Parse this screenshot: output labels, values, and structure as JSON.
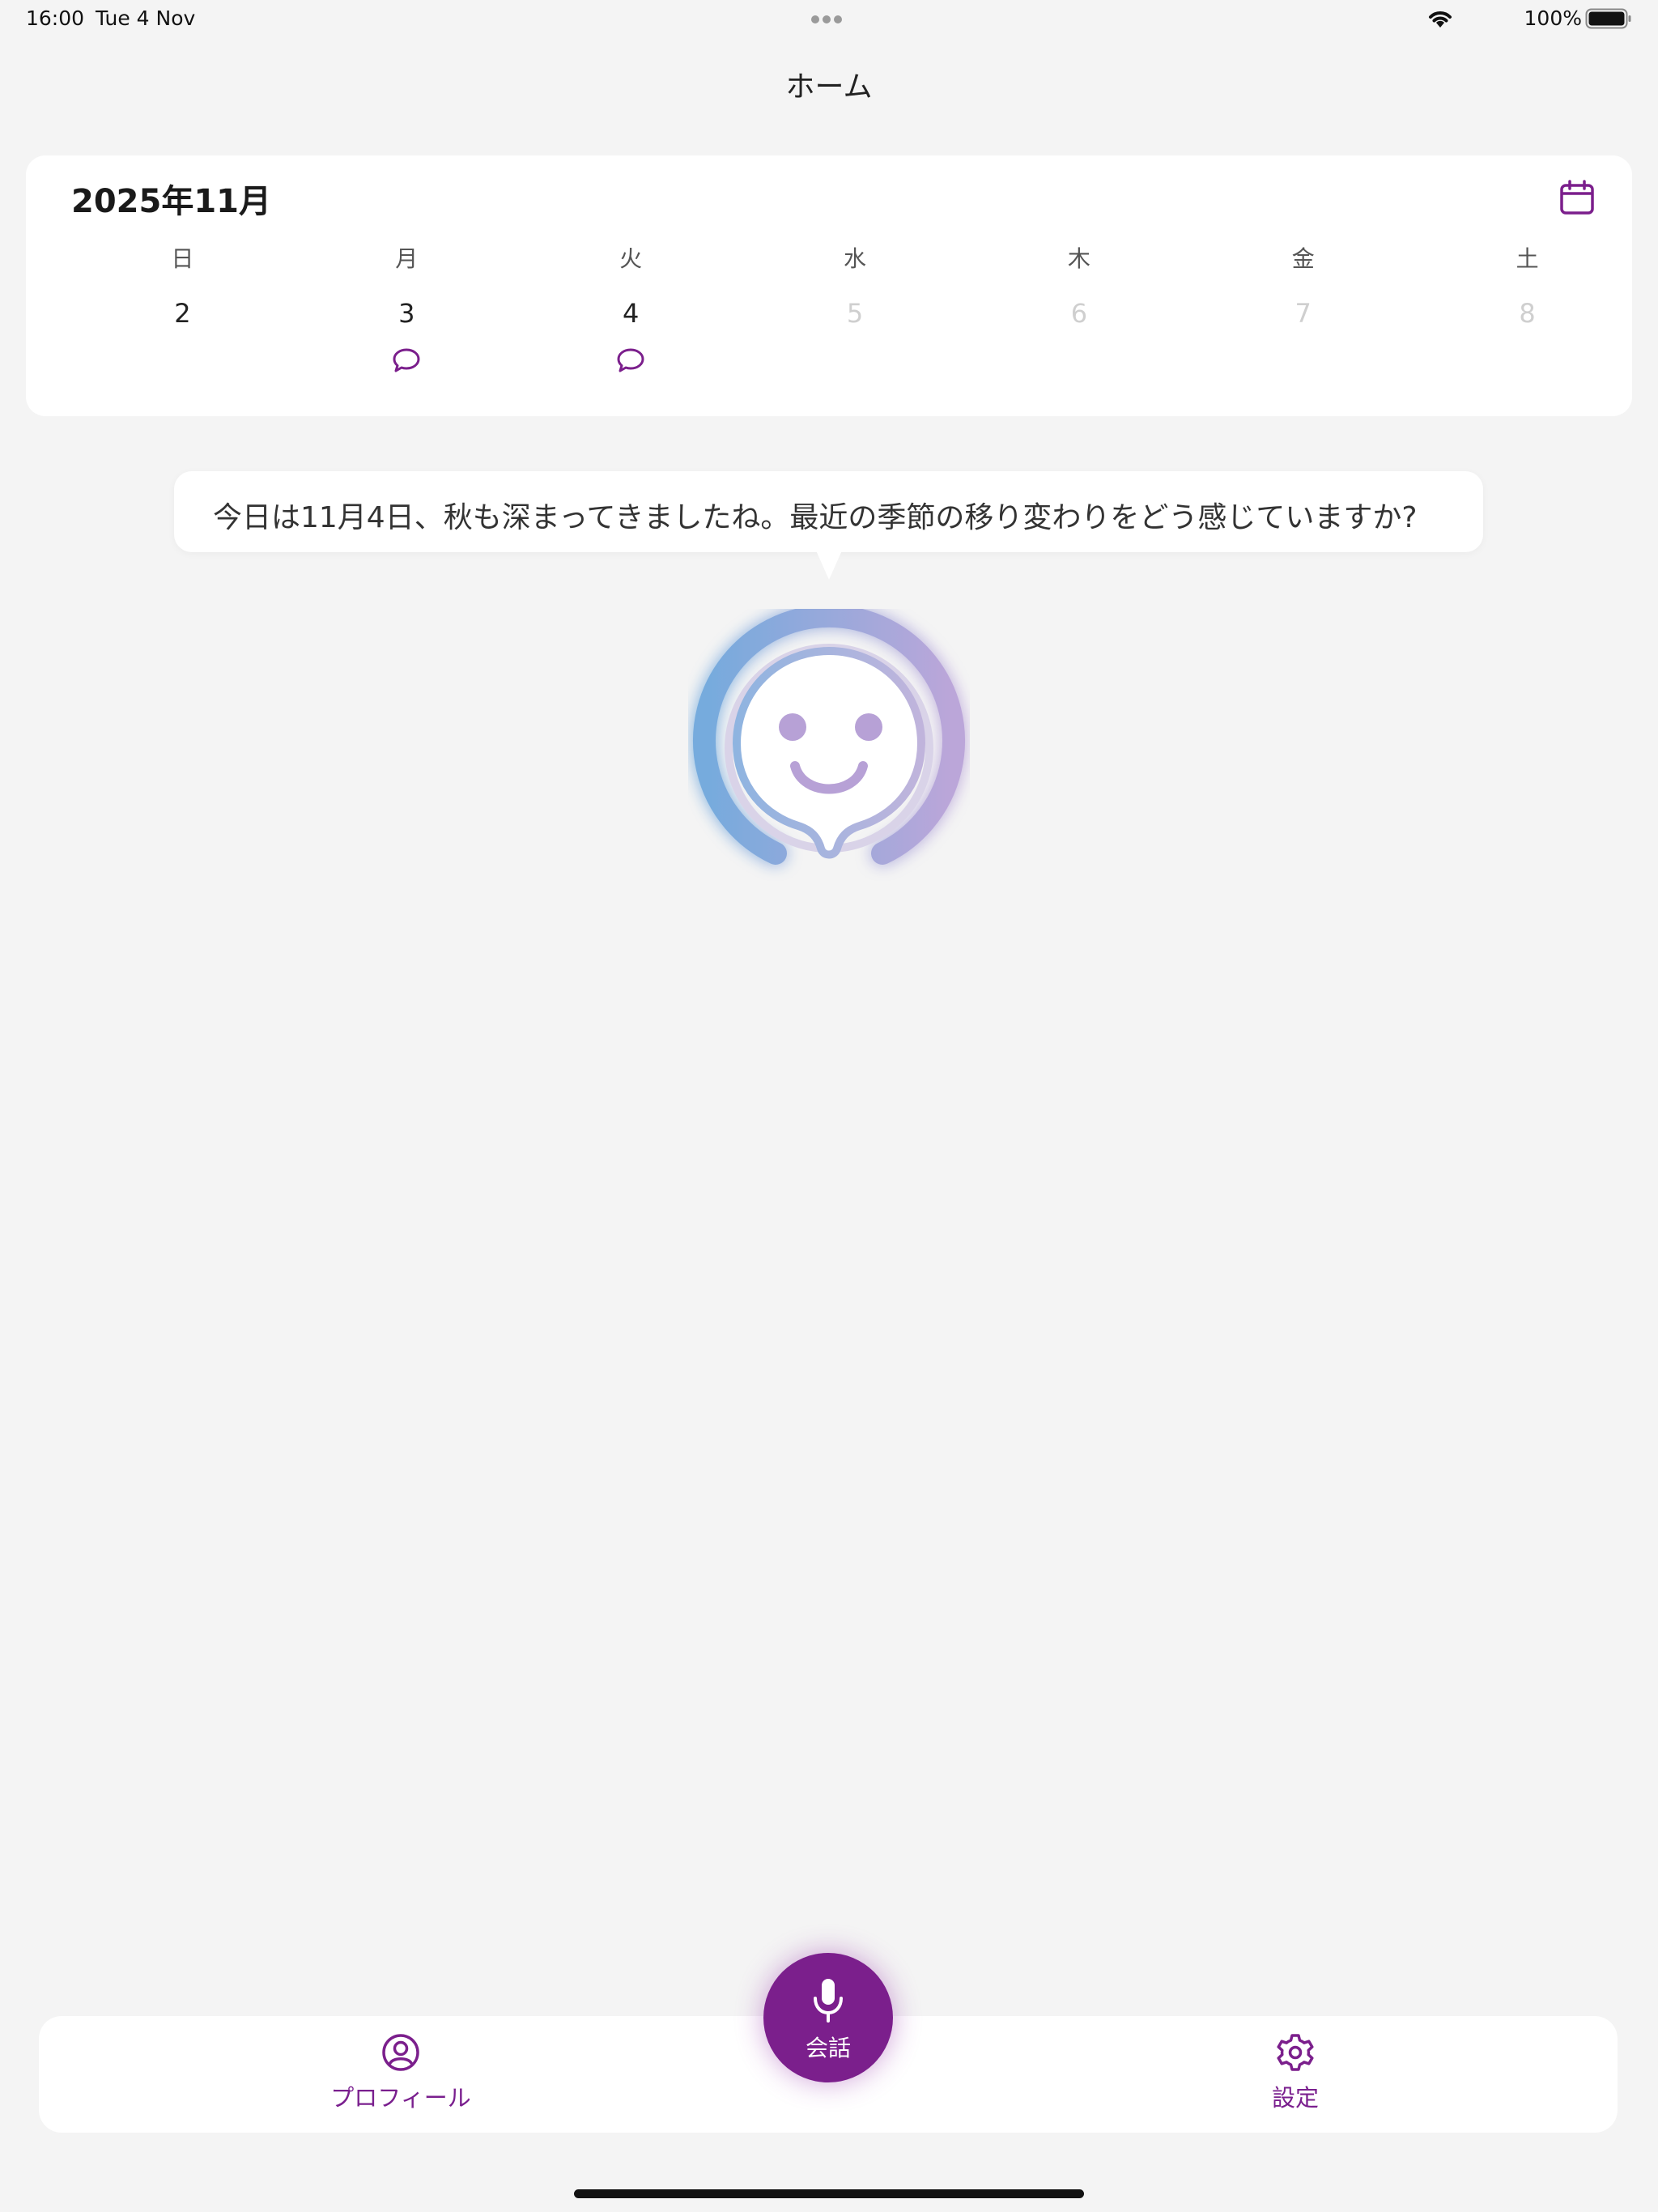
{
  "status_bar": {
    "time": "16:00",
    "date": "Tue 4 Nov",
    "battery": "100%"
  },
  "header": {
    "title": "ホーム"
  },
  "calendar": {
    "month_label": "2025年11月",
    "icon": "calendar-icon",
    "weekdays": [
      "日",
      "月",
      "火",
      "水",
      "木",
      "金",
      "土"
    ],
    "days": [
      {
        "date": "2",
        "has_conversation": false,
        "future": false
      },
      {
        "date": "3",
        "has_conversation": true,
        "future": false
      },
      {
        "date": "4",
        "has_conversation": true,
        "future": false
      },
      {
        "date": "5",
        "has_conversation": false,
        "future": true
      },
      {
        "date": "6",
        "has_conversation": false,
        "future": true
      },
      {
        "date": "7",
        "has_conversation": false,
        "future": true
      },
      {
        "date": "8",
        "has_conversation": false,
        "future": true
      }
    ]
  },
  "assistant": {
    "message": "今日は11月4日、秋も深まってきましたね。最近の季節の移り変わりをどう感じていますか?"
  },
  "bottom_nav": {
    "profile_label": "プロフィール",
    "talk_label": "会話",
    "settings_label": "設定"
  },
  "colors": {
    "accent": "#7b1f8c",
    "background": "#f4f4f4",
    "card": "#ffffff",
    "mascot_blue": "#6fa8dc",
    "mascot_purple": "#b9a2d8"
  }
}
